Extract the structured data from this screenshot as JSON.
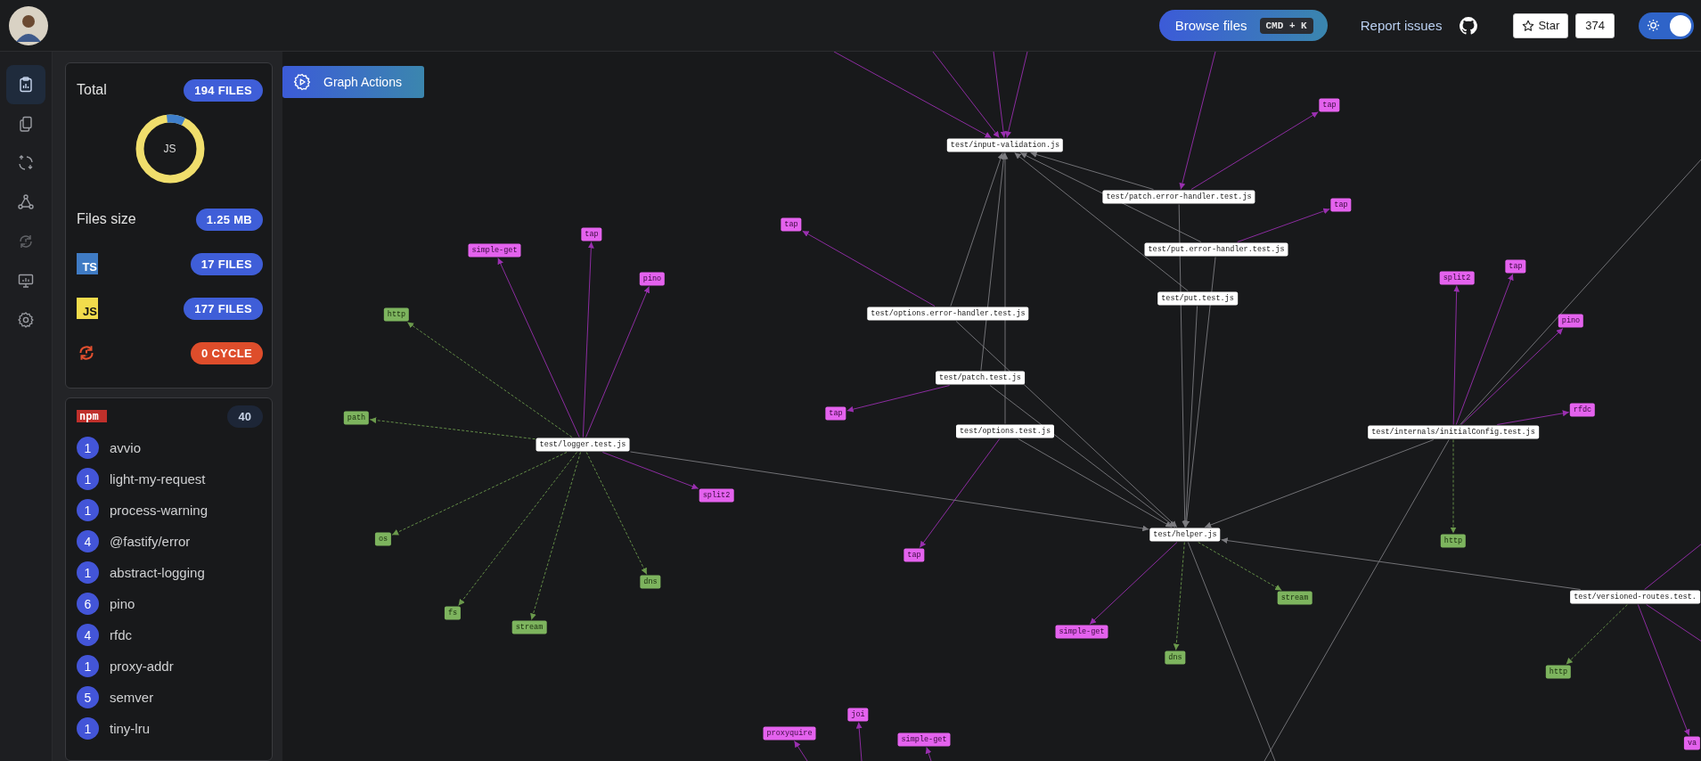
{
  "header": {
    "browse_button": "Browse files",
    "shortcut": "CMD + K",
    "report_link": "Report issues",
    "star_button": "Star",
    "star_count": "374",
    "theme_toggle": {
      "on": true
    }
  },
  "rail": {
    "items": [
      {
        "kind": "report",
        "selected": true
      },
      {
        "kind": "files",
        "selected": false
      },
      {
        "kind": "swap",
        "selected": false
      },
      {
        "kind": "graph",
        "selected": false
      },
      {
        "kind": "cycle",
        "selected": false
      },
      {
        "kind": "monitor",
        "selected": false
      },
      {
        "kind": "settings",
        "selected": false
      }
    ]
  },
  "stats": {
    "total_label": "Total",
    "total": "194 FILES",
    "donut_label": "JS",
    "size_label": "Files size",
    "size": "1.25 MB",
    "languages": [
      {
        "kind": "ts",
        "label": "TS",
        "count": "17 FILES"
      },
      {
        "kind": "js",
        "label": "JS",
        "count": "177 FILES"
      }
    ],
    "cycles": "0 CYCLE"
  },
  "npm": {
    "logo": "npm",
    "count": "40",
    "packages": [
      {
        "count": "1",
        "name": "avvio"
      },
      {
        "count": "1",
        "name": "light-my-request"
      },
      {
        "count": "1",
        "name": "process-warning"
      },
      {
        "count": "4",
        "name": "@fastify/error"
      },
      {
        "count": "1",
        "name": "abstract-logging"
      },
      {
        "count": "6",
        "name": "pino"
      },
      {
        "count": "4",
        "name": "rfdc"
      },
      {
        "count": "1",
        "name": "proxy-addr"
      },
      {
        "count": "5",
        "name": "semver"
      },
      {
        "count": "1",
        "name": "tiny-lru"
      }
    ]
  },
  "graph": {
    "actions_button": "Graph Actions",
    "nodes": [
      {
        "label": "tap",
        "kind": "package"
      },
      {
        "label": "test/input-validation.js",
        "kind": "file"
      },
      {
        "label": "test/patch.error-handler.test.js",
        "kind": "file"
      },
      {
        "label": "tap",
        "kind": "package"
      },
      {
        "label": "simple-get",
        "kind": "package"
      },
      {
        "label": "tap",
        "kind": "package"
      },
      {
        "label": "tap",
        "kind": "package"
      },
      {
        "label": "test/put.error-handler.test.js",
        "kind": "file"
      },
      {
        "label": "pino",
        "kind": "package"
      },
      {
        "label": "split2",
        "kind": "package"
      },
      {
        "label": "tap",
        "kind": "package"
      },
      {
        "label": "http",
        "kind": "builtin"
      },
      {
        "label": "test/options.error-handler.test.js",
        "kind": "file"
      },
      {
        "label": "test/put.test.js",
        "kind": "file"
      },
      {
        "label": "pino",
        "kind": "package"
      },
      {
        "label": "test/patch.test.js",
        "kind": "file"
      },
      {
        "label": "path",
        "kind": "builtin"
      },
      {
        "label": "test/logger.test.js",
        "kind": "file"
      },
      {
        "label": "tap",
        "kind": "package"
      },
      {
        "label": "test/options.test.js",
        "kind": "file"
      },
      {
        "label": "test/internals/initialConfig.test.js",
        "kind": "file"
      },
      {
        "label": "rfdc",
        "kind": "package"
      },
      {
        "label": "split2",
        "kind": "package"
      },
      {
        "label": "os",
        "kind": "builtin"
      },
      {
        "label": "tap",
        "kind": "package"
      },
      {
        "label": "test/helper.js",
        "kind": "file"
      },
      {
        "label": "http",
        "kind": "builtin"
      },
      {
        "label": "dns",
        "kind": "builtin"
      },
      {
        "label": "stream",
        "kind": "builtin"
      },
      {
        "label": "test/versioned-routes.test.",
        "kind": "file"
      },
      {
        "label": "fs",
        "kind": "builtin"
      },
      {
        "label": "stream",
        "kind": "builtin"
      },
      {
        "label": "simple-get",
        "kind": "package"
      },
      {
        "label": "dns",
        "kind": "builtin"
      },
      {
        "label": "http",
        "kind": "builtin"
      },
      {
        "label": "proxyquire",
        "kind": "package"
      },
      {
        "label": "joi",
        "kind": "package"
      },
      {
        "label": "simple-get",
        "kind": "package"
      },
      {
        "label": "va",
        "kind": "package"
      }
    ]
  }
}
